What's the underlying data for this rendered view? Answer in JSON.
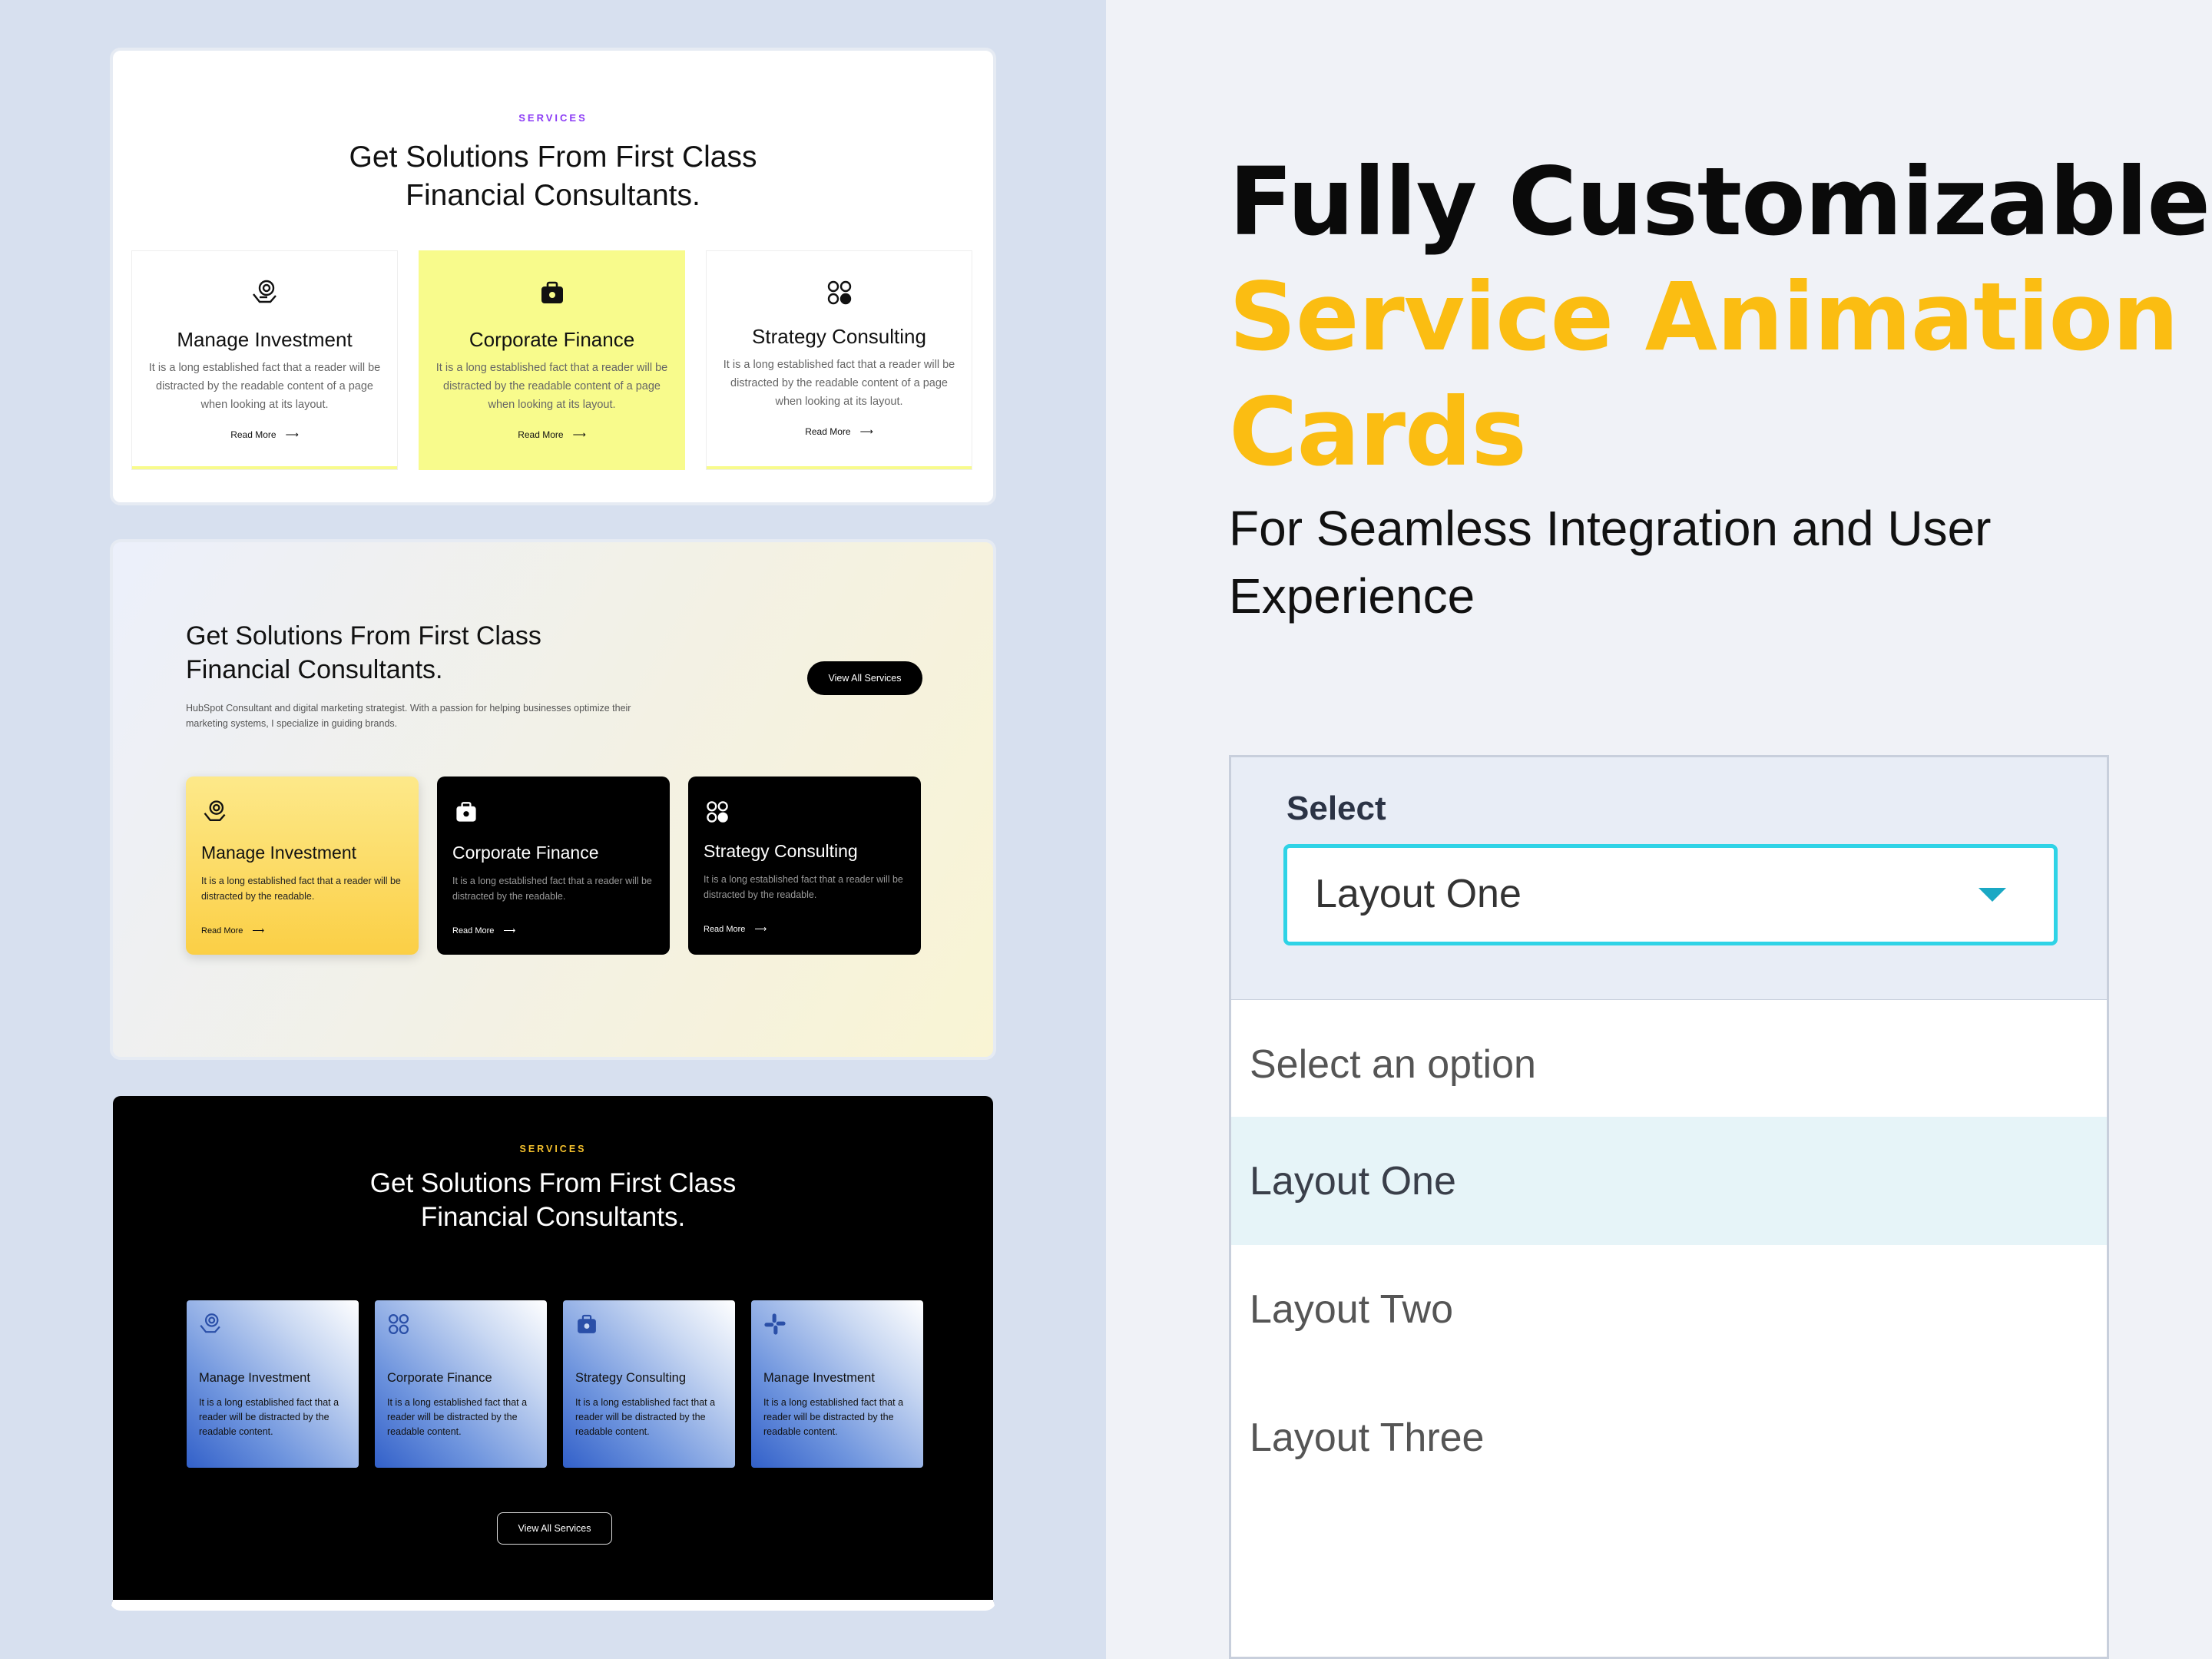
{
  "headline": {
    "line1": "Fully Customizable",
    "line2": "Service Animation",
    "line3": "Cards",
    "subtitle": "For Seamless Integration and User Experience",
    "accent_color": "#fbbd12"
  },
  "select": {
    "label": "Select",
    "value": "Layout One",
    "options": [
      "Select an option",
      "Layout One",
      "Layout Two",
      "Layout Three"
    ],
    "highlight_color": "#2fd3e6"
  },
  "panel1": {
    "eyebrow": "SERVICES",
    "title_line1": "Get Solutions From First Class",
    "title_line2": "Financial Consultants.",
    "cards": [
      {
        "name": "Manage Investment",
        "desc": "It is a long established fact that a reader will be distracted by the readable content of a page when looking at its layout.",
        "link": "Read More",
        "icon": "investment-icon"
      },
      {
        "name": "Corporate Finance",
        "desc": "It is a long established fact that a reader will be distracted by the readable content of a page when looking at its layout.",
        "link": "Read More",
        "icon": "briefcase-icon"
      },
      {
        "name": "Strategy Consulting",
        "desc": "It is a long established fact that a reader will be distracted by the readable content of a page when looking at its layout.",
        "link": "Read More",
        "icon": "strategy-icon"
      }
    ]
  },
  "panel2": {
    "title_line1": "Get Solutions From First Class",
    "title_line2": "Financial Consultants.",
    "subtitle": "HubSpot Consultant and digital marketing strategist. With a passion for helping businesses optimize their marketing systems, I specialize in guiding brands.",
    "button": "View All Services",
    "cards": [
      {
        "name": "Manage Investment",
        "desc": "It is a long established fact that a reader will be distracted by the readable.",
        "link": "Read More",
        "icon": "investment-icon"
      },
      {
        "name": "Corporate Finance",
        "desc": "It is a long established fact that a reader will be distracted by the readable.",
        "link": "Read More",
        "icon": "briefcase-icon"
      },
      {
        "name": "Strategy Consulting",
        "desc": "It is a long established fact that a reader will be distracted by the readable.",
        "link": "Read More",
        "icon": "strategy-icon"
      }
    ]
  },
  "panel3": {
    "eyebrow": "SERVICES",
    "title_line1": "Get Solutions From First Class",
    "title_line2": "Financial Consultants.",
    "button": "View All Services",
    "cards": [
      {
        "name": "Manage Investment",
        "desc": "It is a long established fact that a reader will be distracted by the readable content.",
        "icon": "investment-icon"
      },
      {
        "name": "Corporate Finance",
        "desc": "It is a long established fact that a reader will be distracted by the readable content.",
        "icon": "strategy-icon"
      },
      {
        "name": "Strategy Consulting",
        "desc": "It is a long established fact that a reader will be distracted by the readable content.",
        "icon": "briefcase-icon"
      },
      {
        "name": "Manage Investment",
        "desc": "It is a long established fact that a reader will be distracted by the readable content.",
        "icon": "slack-icon"
      }
    ]
  }
}
